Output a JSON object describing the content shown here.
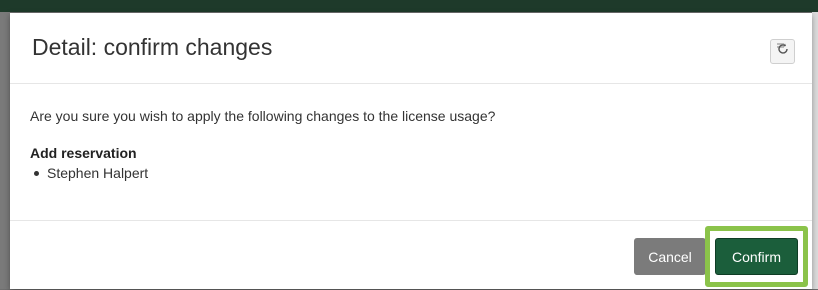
{
  "dialog": {
    "title": "Detail: confirm changes",
    "refresh_icon": "refresh-icon",
    "question": "Are you sure you wish to apply the following changes to the license usage?",
    "section_title": "Add reservation",
    "reservations": [
      "Stephen Halpert"
    ],
    "cancel_label": "Cancel",
    "confirm_label": "Confirm"
  },
  "colors": {
    "primary": "#1b5e3b",
    "highlight": "#8bc34a",
    "secondary": "#7b7b7b"
  }
}
